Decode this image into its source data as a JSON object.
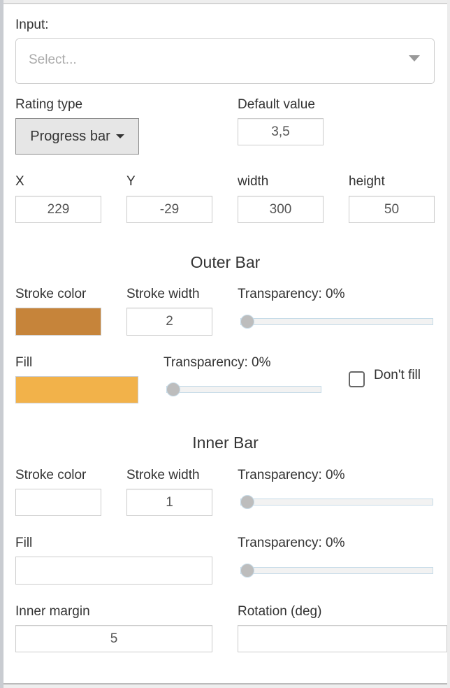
{
  "input": {
    "label": "Input:",
    "placeholder": "Select..."
  },
  "rating_type": {
    "label": "Rating type",
    "value": "Progress bar"
  },
  "default_value": {
    "label": "Default value",
    "value": "3,5"
  },
  "geometry": {
    "x": {
      "label": "X",
      "value": "229"
    },
    "y": {
      "label": "Y",
      "value": "-29"
    },
    "width": {
      "label": "width",
      "value": "300"
    },
    "height": {
      "label": "height",
      "value": "50"
    }
  },
  "outer_bar": {
    "title": "Outer Bar",
    "stroke_color": {
      "label": "Stroke color",
      "value": "#c6843a"
    },
    "stroke_width": {
      "label": "Stroke width",
      "value": "2"
    },
    "stroke_transparency": {
      "label": "Transparency: 0%",
      "percent": 0
    },
    "fill": {
      "label": "Fill",
      "value": "#f2b24a"
    },
    "fill_transparency": {
      "label": "Transparency: 0%",
      "percent": 0
    },
    "dont_fill": {
      "label": "Don't fill",
      "checked": false
    }
  },
  "inner_bar": {
    "title": "Inner Bar",
    "stroke_color": {
      "label": "Stroke color",
      "value": ""
    },
    "stroke_width": {
      "label": "Stroke width",
      "value": "1"
    },
    "stroke_transparency": {
      "label": "Transparency: 0%",
      "percent": 0
    },
    "fill": {
      "label": "Fill",
      "value": ""
    },
    "fill_transparency": {
      "label": "Transparency: 0%",
      "percent": 0
    },
    "inner_margin": {
      "label": "Inner margin",
      "value": "5"
    },
    "rotation": {
      "label": "Rotation (deg)",
      "value": ""
    }
  }
}
